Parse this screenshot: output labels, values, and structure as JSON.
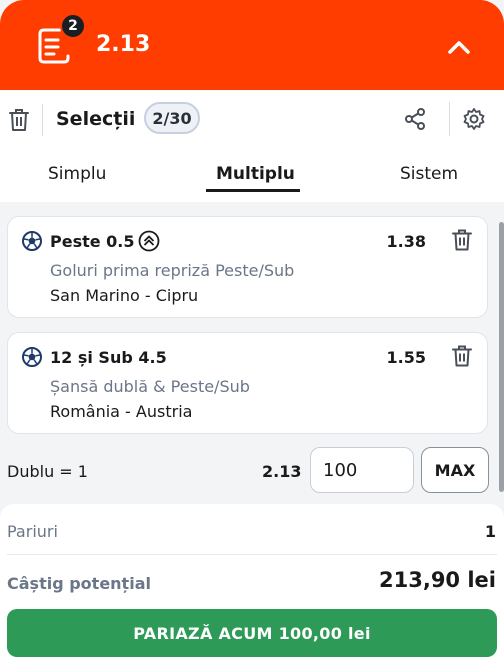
{
  "header": {
    "badge_count": "2",
    "total_odds": "2.13",
    "icons": {
      "betslip": "betslip-icon",
      "collapse": "chevron-up-icon"
    },
    "colors": {
      "brand": "#ff3d00"
    }
  },
  "panel": {
    "title": "Selecții",
    "counter": "2/30",
    "icons": {
      "clear": "trash-icon",
      "share": "share-icon",
      "settings": "gear-icon"
    }
  },
  "tabs": [
    {
      "label": "Simplu",
      "active": false
    },
    {
      "label": "Multiplu",
      "active": true
    },
    {
      "label": "Sistem",
      "active": false
    }
  ],
  "selections": [
    {
      "name": "Peste 0.5",
      "odds": "1.38",
      "market": "Goluri prima repriză Peste/Sub",
      "event": "San Marino - Cipru",
      "icon": "soccer-ball-icon",
      "boost_icon": "odds-boost-icon"
    },
    {
      "name": "12 și Sub 4.5",
      "odds": "1.55",
      "market": "Șansă dublă & Peste/Sub",
      "event": "România - Austria",
      "icon": "soccer-ball-icon"
    }
  ],
  "combo": {
    "label": "Dublu = 1",
    "odds": "2.13",
    "stake_value": "100",
    "max_label": "MAX"
  },
  "summary": {
    "bets_label": "Pariuri",
    "bets_value": "1",
    "win_label": "Câștig potențial",
    "win_value": "213,90 lei",
    "cta_label": "PARIAZĂ ACUM 100,00 lei",
    "cta_color": "#2e9a57"
  }
}
